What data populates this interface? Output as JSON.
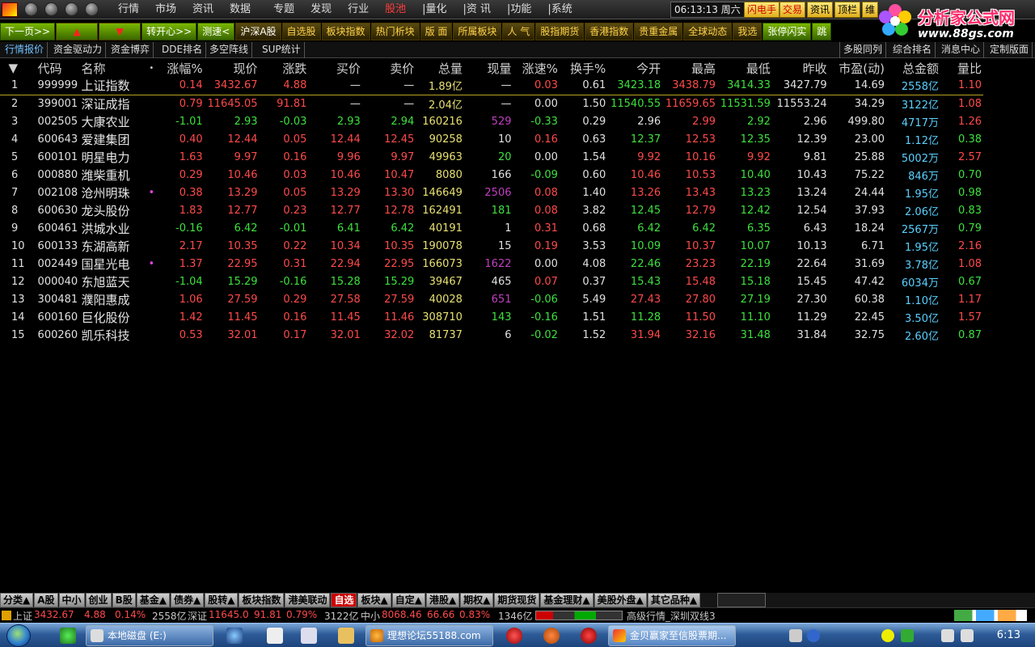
{
  "menubar": {
    "items": [
      "行情",
      "市场",
      "资讯",
      "数据",
      "专题",
      "发现",
      "行业",
      "股池",
      "|量化",
      "|资 讯",
      "|功能",
      "|系统"
    ],
    "active_item": "股池",
    "clock": "06:13:13 周六",
    "right_buttons": [
      "闪电手",
      "交易",
      "资讯",
      "顶栏",
      "维"
    ]
  },
  "brand": {
    "title": "分析家公式网",
    "url": "www.88gs.com"
  },
  "toolbar2": {
    "buttons": [
      "下一页>>",
      "▲",
      "▼",
      "转开心>>",
      "测速<",
      "沪深A股",
      "自选股",
      "板块指数",
      "热门析块",
      "版 面",
      "所属板块",
      "人 气",
      "股指期货",
      "香港指数",
      "贵重金属",
      "全球动态",
      "我选",
      "张停闪实",
      "跳"
    ]
  },
  "tabs": {
    "items": [
      "行情报价",
      "资金驱动力",
      "资金博弈",
      "DDE排名",
      "多空阵线",
      "SUP统计"
    ],
    "right_items": [
      "多股同列",
      "综合排名",
      "消息中心",
      "定制版面"
    ],
    "active": "行情报价"
  },
  "table": {
    "headers": [
      "",
      "代码",
      "名称",
      "•",
      "涨幅%",
      "现价",
      "涨跌",
      "买价",
      "卖价",
      "总量",
      "现量",
      "涨速%",
      "换手%",
      "今开",
      "最高",
      "最低",
      "昨收",
      "市盈(动)",
      "总金额",
      "量比"
    ],
    "rows": [
      {
        "idx": "1",
        "code": "999999",
        "name": "上证指数",
        "mark": "",
        "chg_pct": "0.14",
        "price": "3432.67",
        "chg": "4.88",
        "bid": "—",
        "ask": "—",
        "vol": "1.89亿",
        "cur_vol": "—",
        "speed": "0.03",
        "turnover": "0.61",
        "open": "3423.18",
        "high": "3438.79",
        "low": "3414.33",
        "prev": "3427.79",
        "pe": "14.69",
        "amount": "2558亿",
        "vol_ratio": "1.10"
      },
      {
        "idx": "2",
        "code": "399001",
        "name": "深证成指",
        "mark": "",
        "chg_pct": "0.79",
        "price": "11645.05",
        "chg": "91.81",
        "bid": "—",
        "ask": "—",
        "vol": "2.04亿",
        "cur_vol": "—",
        "speed": "0.00",
        "turnover": "1.50",
        "open": "11540.55",
        "high": "11659.65",
        "low": "11531.59",
        "prev": "11553.24",
        "pe": "34.29",
        "amount": "3122亿",
        "vol_ratio": "1.08"
      },
      {
        "idx": "3",
        "code": "002505",
        "name": "大康农业",
        "mark": "",
        "chg_pct": "-1.01",
        "price": "2.93",
        "chg": "-0.03",
        "bid": "2.93",
        "ask": "2.94",
        "vol": "160216",
        "cur_vol": "529",
        "speed": "-0.33",
        "turnover": "0.29",
        "open": "2.96",
        "high": "2.99",
        "low": "2.92",
        "prev": "2.96",
        "pe": "499.80",
        "amount": "4717万",
        "vol_ratio": "1.26"
      },
      {
        "idx": "4",
        "code": "600643",
        "name": "爱建集团",
        "mark": "",
        "chg_pct": "0.40",
        "price": "12.44",
        "chg": "0.05",
        "bid": "12.44",
        "ask": "12.45",
        "vol": "90258",
        "cur_vol": "10",
        "speed": "0.16",
        "turnover": "0.63",
        "open": "12.37",
        "high": "12.53",
        "low": "12.35",
        "prev": "12.39",
        "pe": "23.00",
        "amount": "1.12亿",
        "vol_ratio": "0.38"
      },
      {
        "idx": "5",
        "code": "600101",
        "name": "明星电力",
        "mark": "",
        "chg_pct": "1.63",
        "price": "9.97",
        "chg": "0.16",
        "bid": "9.96",
        "ask": "9.97",
        "vol": "49963",
        "cur_vol": "20",
        "speed": "0.00",
        "turnover": "1.54",
        "open": "9.92",
        "high": "10.16",
        "low": "9.92",
        "prev": "9.81",
        "pe": "25.88",
        "amount": "5002万",
        "vol_ratio": "2.57"
      },
      {
        "idx": "6",
        "code": "000880",
        "name": "潍柴重机",
        "mark": "",
        "chg_pct": "0.29",
        "price": "10.46",
        "chg": "0.03",
        "bid": "10.46",
        "ask": "10.47",
        "vol": "8080",
        "cur_vol": "166",
        "speed": "-0.09",
        "turnover": "0.60",
        "open": "10.46",
        "high": "10.53",
        "low": "10.40",
        "prev": "10.43",
        "pe": "75.22",
        "amount": "846万",
        "vol_ratio": "0.70"
      },
      {
        "idx": "7",
        "code": "002108",
        "name": "沧州明珠",
        "mark": "•",
        "chg_pct": "0.38",
        "price": "13.29",
        "chg": "0.05",
        "bid": "13.29",
        "ask": "13.30",
        "vol": "146649",
        "cur_vol": "2506",
        "speed": "0.08",
        "turnover": "1.40",
        "open": "13.26",
        "high": "13.43",
        "low": "13.23",
        "prev": "13.24",
        "pe": "24.44",
        "amount": "1.95亿",
        "vol_ratio": "0.98"
      },
      {
        "idx": "8",
        "code": "600630",
        "name": "龙头股份",
        "mark": "",
        "chg_pct": "1.83",
        "price": "12.77",
        "chg": "0.23",
        "bid": "12.77",
        "ask": "12.78",
        "vol": "162491",
        "cur_vol": "181",
        "speed": "0.08",
        "turnover": "3.82",
        "open": "12.45",
        "high": "12.79",
        "low": "12.42",
        "prev": "12.54",
        "pe": "37.93",
        "amount": "2.06亿",
        "vol_ratio": "0.83"
      },
      {
        "idx": "9",
        "code": "600461",
        "name": "洪城水业",
        "mark": "",
        "chg_pct": "-0.16",
        "price": "6.42",
        "chg": "-0.01",
        "bid": "6.41",
        "ask": "6.42",
        "vol": "40191",
        "cur_vol": "1",
        "speed": "0.31",
        "turnover": "0.68",
        "open": "6.42",
        "high": "6.42",
        "low": "6.35",
        "prev": "6.43",
        "pe": "18.24",
        "amount": "2567万",
        "vol_ratio": "0.79"
      },
      {
        "idx": "10",
        "code": "600133",
        "name": "东湖高新",
        "mark": "",
        "chg_pct": "2.17",
        "price": "10.35",
        "chg": "0.22",
        "bid": "10.34",
        "ask": "10.35",
        "vol": "190078",
        "cur_vol": "15",
        "speed": "0.19",
        "turnover": "3.53",
        "open": "10.09",
        "high": "10.37",
        "low": "10.07",
        "prev": "10.13",
        "pe": "6.71",
        "amount": "1.95亿",
        "vol_ratio": "2.16"
      },
      {
        "idx": "11",
        "code": "002449",
        "name": "国星光电",
        "mark": "•",
        "chg_pct": "1.37",
        "price": "22.95",
        "chg": "0.31",
        "bid": "22.94",
        "ask": "22.95",
        "vol": "166073",
        "cur_vol": "1622",
        "speed": "0.00",
        "turnover": "4.08",
        "open": "22.46",
        "high": "23.23",
        "low": "22.19",
        "prev": "22.64",
        "pe": "31.69",
        "amount": "3.78亿",
        "vol_ratio": "1.08"
      },
      {
        "idx": "12",
        "code": "000040",
        "name": "东旭蓝天",
        "mark": "",
        "chg_pct": "-1.04",
        "price": "15.29",
        "chg": "-0.16",
        "bid": "15.28",
        "ask": "15.29",
        "vol": "39467",
        "cur_vol": "465",
        "speed": "0.07",
        "turnover": "0.37",
        "open": "15.43",
        "high": "15.48",
        "low": "15.18",
        "prev": "15.45",
        "pe": "47.42",
        "amount": "6034万",
        "vol_ratio": "0.67"
      },
      {
        "idx": "13",
        "code": "300481",
        "name": "濮阳惠成",
        "mark": "",
        "chg_pct": "1.06",
        "price": "27.59",
        "chg": "0.29",
        "bid": "27.58",
        "ask": "27.59",
        "vol": "40028",
        "cur_vol": "651",
        "speed": "-0.06",
        "turnover": "5.49",
        "open": "27.43",
        "high": "27.80",
        "low": "27.19",
        "prev": "27.30",
        "pe": "60.38",
        "amount": "1.10亿",
        "vol_ratio": "1.17"
      },
      {
        "idx": "14",
        "code": "600160",
        "name": "巨化股份",
        "mark": "",
        "chg_pct": "1.42",
        "price": "11.45",
        "chg": "0.16",
        "bid": "11.45",
        "ask": "11.46",
        "vol": "308710",
        "cur_vol": "143",
        "speed": "-0.16",
        "turnover": "1.51",
        "open": "11.28",
        "high": "11.50",
        "low": "11.10",
        "prev": "11.29",
        "pe": "22.45",
        "amount": "3.50亿",
        "vol_ratio": "1.57"
      },
      {
        "idx": "15",
        "code": "600260",
        "name": "凯乐科技",
        "mark": "",
        "chg_pct": "0.53",
        "price": "32.01",
        "chg": "0.17",
        "bid": "32.01",
        "ask": "32.02",
        "vol": "81737",
        "cur_vol": "6",
        "speed": "-0.02",
        "turnover": "1.52",
        "open": "31.94",
        "high": "32.16",
        "low": "31.48",
        "prev": "31.84",
        "pe": "32.75",
        "amount": "2.60亿",
        "vol_ratio": "0.87"
      }
    ]
  },
  "catbar": {
    "items": [
      "分类▲",
      "A股",
      "中小",
      "创业",
      "B股",
      "基金▲",
      "债券▲",
      "股转▲",
      "板块指数",
      "港美联动",
      "自选",
      "板块▲",
      "自定▲",
      "港股▲",
      "期权▲",
      "期货现货",
      "基金理财▲",
      "美股外盘▲",
      "其它品种▲"
    ],
    "active": "自选"
  },
  "statusbar": {
    "sh_label": "上证",
    "sh_value": "3432.67",
    "sh_chg": "4.88",
    "sh_pct": "0.14%",
    "sh_amount": "2558亿",
    "sz_label": "深证",
    "sz_value": "11645.0",
    "sz_chg": "91.81",
    "sz_pct": "0.79%",
    "sz_amount": "3122亿",
    "zx_label": "中小",
    "zx_value": "8068.46",
    "zx_chg": "66.66",
    "zx_pct": "0.83%",
    "zx_amount": "1346亿",
    "market_info": "高级行情_深圳双线3"
  },
  "taskbar": {
    "tasks": [
      "本地磁盘 (E:)",
      "理想论坛55188.com",
      "金贝赢家至信股票期..."
    ],
    "time": "6:13"
  },
  "colors": {
    "up": "#ff4a4a",
    "down": "#3ee03e",
    "volume": "#e8e070",
    "amount": "#5ad0ff",
    "current_volume": "#c040c0",
    "active_red": "#cc0000"
  }
}
